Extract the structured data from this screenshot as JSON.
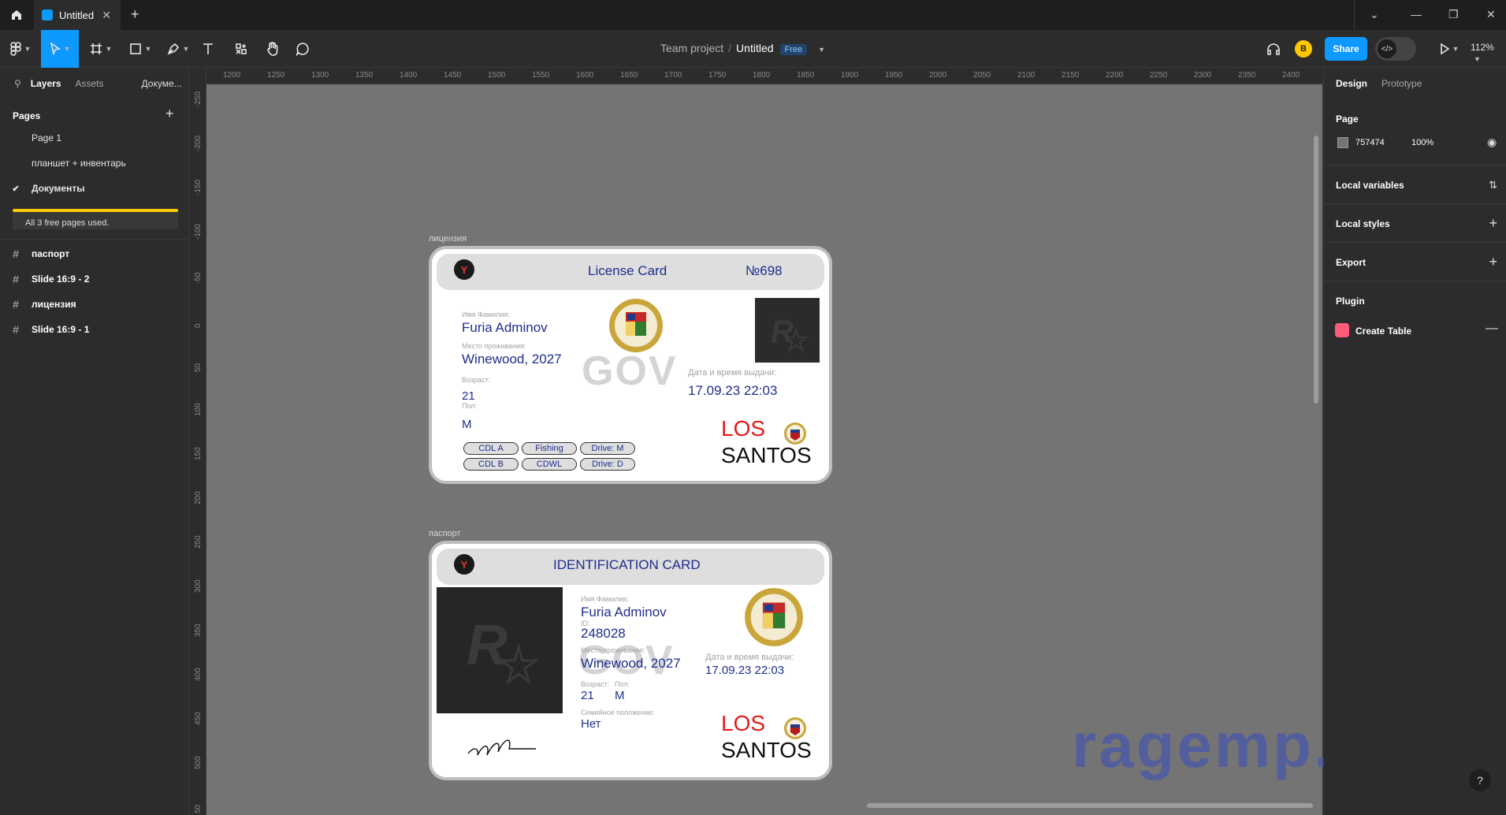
{
  "titlebar": {
    "tab_title": "Untitled",
    "new_tab": "+",
    "window_controls": [
      "⌄",
      "—",
      "❐",
      "✕"
    ]
  },
  "toolbar": {
    "project": "Team project",
    "file_name": "Untitled",
    "plan_badge": "Free",
    "user_initial": "B",
    "share_label": "Share",
    "zoom": "112%",
    "tools": [
      "main-menu-icon",
      "move-icon",
      "frame-icon",
      "rectangle-icon",
      "pen-icon",
      "text-icon",
      "components-icon",
      "hand-icon",
      "comment-icon"
    ]
  },
  "left_panel": {
    "tabs": [
      "Layers",
      "Assets",
      "Докуме..."
    ],
    "pages_title": "Pages",
    "pages": [
      {
        "name": "Page 1",
        "selected": false
      },
      {
        "name": "планшет + инвентарь",
        "selected": false
      },
      {
        "name": "Документы",
        "selected": true
      }
    ],
    "pages_notice": "All 3 free pages used.",
    "layers": [
      "паспорт",
      "Slide 16:9 - 2",
      "лицензия",
      "Slide 16:9 - 1"
    ]
  },
  "rulers": {
    "top": [
      "1200",
      "1250",
      "1300",
      "1350",
      "1400",
      "1450",
      "1500",
      "1550",
      "1600",
      "1650",
      "1700",
      "1750",
      "1800",
      "1850",
      "1900",
      "1950",
      "2000",
      "2050",
      "2100",
      "2150",
      "2200",
      "2250",
      "2300",
      "2350",
      "2400"
    ],
    "left": [
      "-250",
      "-200",
      "-150",
      "-100",
      "-50",
      "0",
      "50",
      "100",
      "150",
      "200",
      "250",
      "300",
      "350",
      "400",
      "450",
      "500",
      "50"
    ]
  },
  "license_card": {
    "frame_label": "лицензия",
    "logo": "Y",
    "title": "License Card",
    "number": "№698",
    "name_label": "Имя Фамилия:",
    "name": "Furia Adminov",
    "residence_label": "Место проживания:",
    "residence": "Winewood, 2027",
    "age_label": "Возраст:",
    "age": "21",
    "sex_label": "Пол:",
    "sex": "М",
    "issue_label": "Дата и время выдачи:",
    "issue": "17.09.23 22:03",
    "watermark": "GOV",
    "city_top": "LOS",
    "city_bottom": "SANTOS",
    "badges": [
      "CDL A",
      "Fishing",
      "Drive: M",
      "CDL B",
      "CDWL",
      "Drive: D"
    ]
  },
  "id_card": {
    "frame_label": "паспорт",
    "logo": "Y",
    "title": "IDENTIFICATION CARD",
    "name_label": "Имя Фамилия:",
    "name": "Furia Adminov",
    "id_label": "ID:",
    "id": "248028",
    "residence_label": "Место проживания:",
    "residence": "Winewood, 2027",
    "age_label": "Возраст:",
    "age": "21",
    "sex_label": "Пол:",
    "sex": "М",
    "marital_label": "Семейное положение:",
    "marital": "Нет",
    "issue_label": "Дата и время выдачи:",
    "issue": "17.09.23 22:03",
    "watermark": "GOV",
    "city_top": "LOS",
    "city_bottom": "SANTOS"
  },
  "watermark_site": "ragemp.pro",
  "right_panel": {
    "tabs": [
      "Design",
      "Prototype"
    ],
    "page_title": "Page",
    "page_color": "757474",
    "page_opacity": "100%",
    "sections": [
      "Local variables",
      "Local styles",
      "Export",
      "Plugin"
    ],
    "plugin_name": "Create Table",
    "help": "?"
  },
  "colors": {
    "accent": "#0d99ff",
    "canvas": "#757474",
    "card_text": "#1e2d8c",
    "los_red": "#e31b1b",
    "notice_bar": "#ffc700"
  }
}
